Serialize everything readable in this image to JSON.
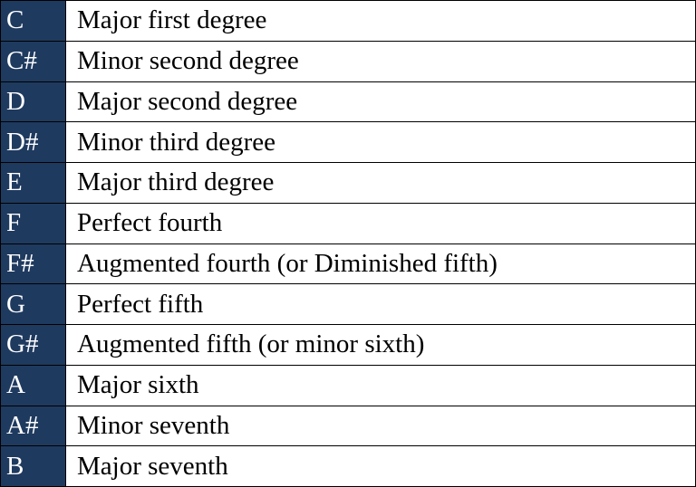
{
  "rows": [
    {
      "note": "C",
      "desc": "Major first degree"
    },
    {
      "note": "C#",
      "desc": "Minor second degree"
    },
    {
      "note": "D",
      "desc": "Major second degree"
    },
    {
      "note": "D#",
      "desc": "Minor third degree"
    },
    {
      "note": "E",
      "desc": "Major third degree"
    },
    {
      "note": "F",
      "desc": "Perfect fourth"
    },
    {
      "note": "F#",
      "desc": "Augmented fourth (or Diminished fifth)"
    },
    {
      "note": "G",
      "desc": "Perfect fifth"
    },
    {
      "note": "G#",
      "desc": "Augmented fifth (or minor sixth)"
    },
    {
      "note": "A",
      "desc": "Major sixth"
    },
    {
      "note": "A#",
      "desc": "Minor seventh"
    },
    {
      "note": "B",
      "desc": "Major seventh"
    }
  ]
}
